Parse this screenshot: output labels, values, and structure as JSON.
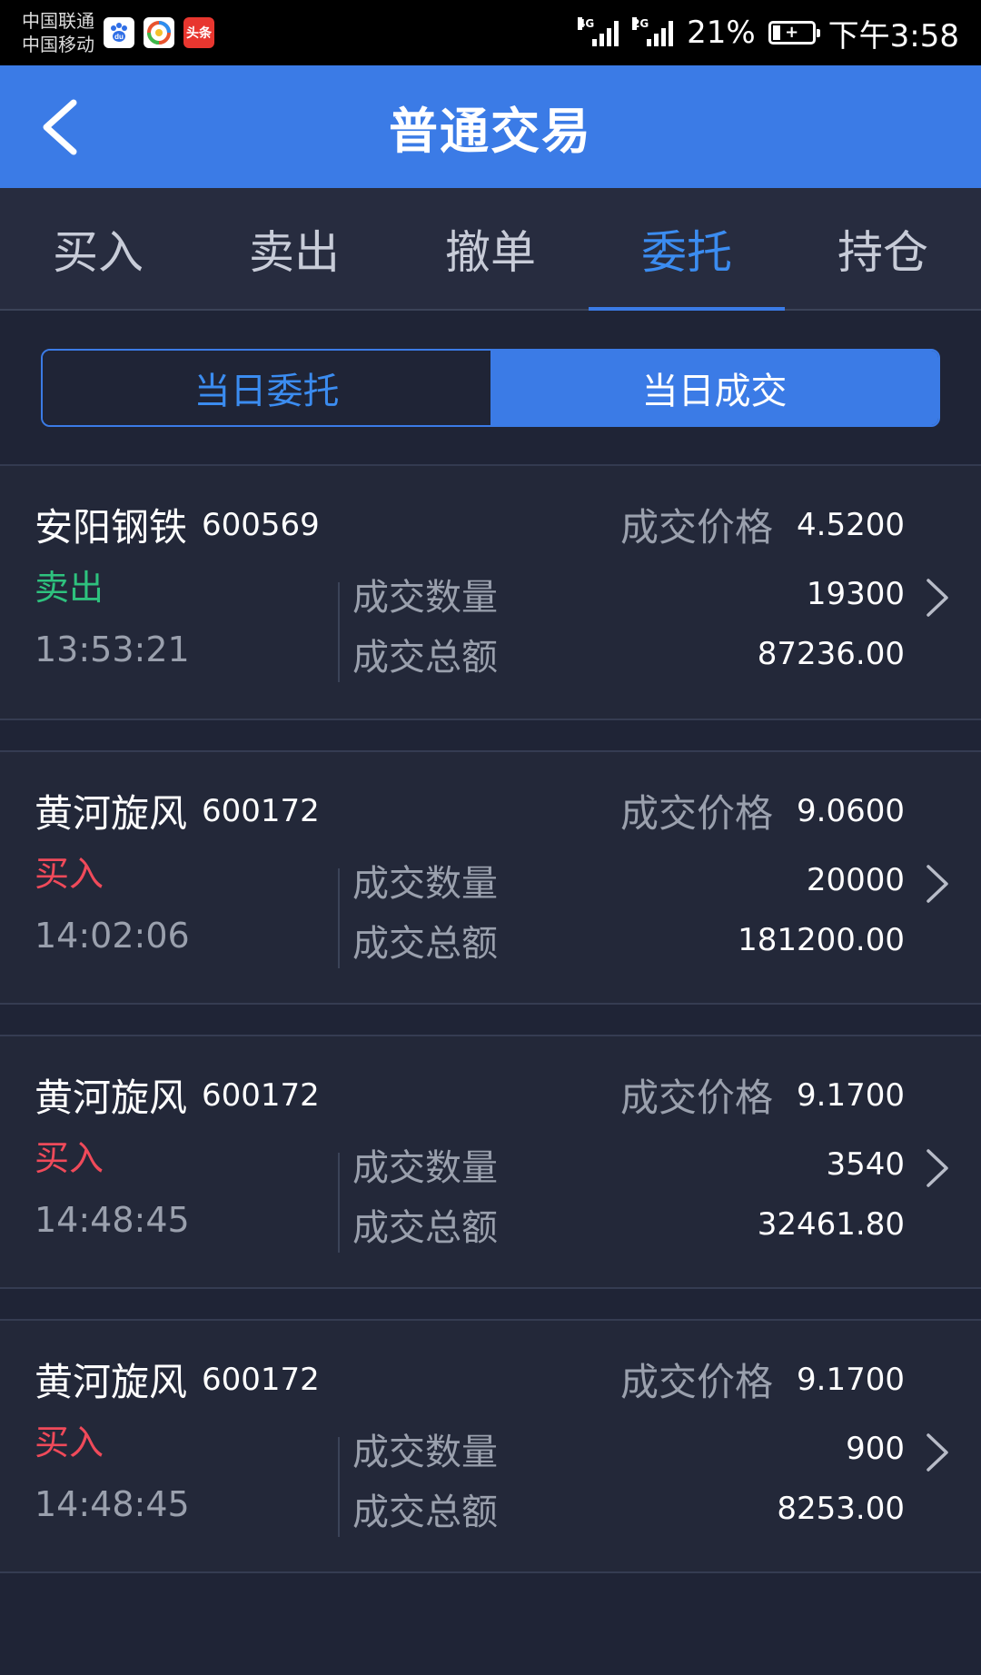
{
  "status_bar": {
    "carrier1": "中国联通",
    "carrier2": "中国移动",
    "net1": "4G",
    "net2": "2G",
    "battery": "21%",
    "battery_level": 0.21,
    "time": "下午3:58",
    "app_icons": [
      "baidu-icon",
      "browser-icon",
      "toutiao-icon"
    ],
    "toutiao_text": "头条"
  },
  "header": {
    "title": "普通交易"
  },
  "tabs": [
    {
      "label": "买入",
      "active": false
    },
    {
      "label": "卖出",
      "active": false
    },
    {
      "label": "撤单",
      "active": false
    },
    {
      "label": "委托",
      "active": true
    },
    {
      "label": "持仓",
      "active": false
    }
  ],
  "segment": {
    "left": "当日委托",
    "right": "当日成交",
    "selected": "right"
  },
  "labels": {
    "price": "成交价格",
    "qty": "成交数量",
    "amount": "成交总额"
  },
  "trades": [
    {
      "name": "安阳钢铁",
      "code": "600569",
      "price": "4.5200",
      "side": "卖出",
      "side_type": "sell",
      "time": "13:53:21",
      "qty": "19300",
      "amount": "87236.00"
    },
    {
      "name": "黄河旋风",
      "code": "600172",
      "price": "9.0600",
      "side": "买入",
      "side_type": "buy",
      "time": "14:02:06",
      "qty": "20000",
      "amount": "181200.00"
    },
    {
      "name": "黄河旋风",
      "code": "600172",
      "price": "9.1700",
      "side": "买入",
      "side_type": "buy",
      "time": "14:48:45",
      "qty": "3540",
      "amount": "32461.80"
    },
    {
      "name": "黄河旋风",
      "code": "600172",
      "price": "9.1700",
      "side": "买入",
      "side_type": "buy",
      "time": "14:48:45",
      "qty": "900",
      "amount": "8253.00"
    }
  ],
  "colors": {
    "accent": "#3b7be6",
    "sell": "#2ec27e",
    "buy": "#f04a5a"
  }
}
